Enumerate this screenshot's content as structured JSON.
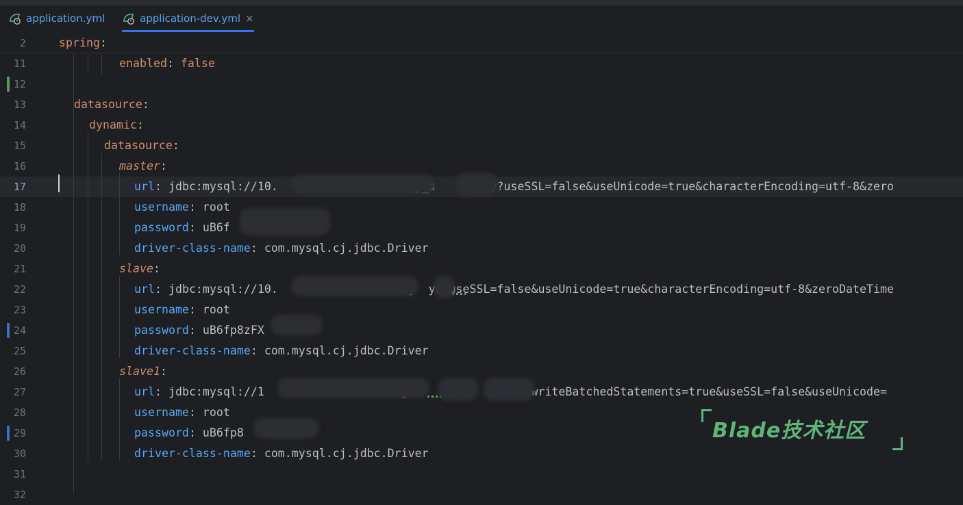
{
  "tabs": [
    {
      "label": "application.yml",
      "active": false
    },
    {
      "label": "application-dev.yml",
      "active": true,
      "close": "×"
    }
  ],
  "sticky": {
    "num": "2",
    "key": "spring",
    "colon": ":"
  },
  "lines": [
    {
      "num": "11",
      "indent": "    ",
      "key": "enabled",
      "colon": ": ",
      "value": "false"
    },
    {
      "num": "12"
    },
    {
      "num": "13",
      "indent": " ",
      "key": "datasource",
      "colon": ":"
    },
    {
      "num": "14",
      "indent": "  ",
      "key": "dynamic",
      "colon": ":"
    },
    {
      "num": "15",
      "indent": "   ",
      "key": "datasource",
      "colon": ":"
    },
    {
      "num": "16",
      "indent": "    ",
      "key": "master",
      "colon": ":"
    },
    {
      "num": "17",
      "indent": "     ",
      "key": "url",
      "colon": ": ",
      "value": "jdbc:mysql://10.                    y_s     city?useSSL=false&useUnicode=true&characterEncoding=utf-8&zero"
    },
    {
      "num": "18",
      "indent": "     ",
      "key": "username",
      "colon": ": ",
      "value": "root"
    },
    {
      "num": "19",
      "indent": "     ",
      "key": "password",
      "colon": ": ",
      "value": "uB6f"
    },
    {
      "num": "20",
      "indent": "     ",
      "key": "driver-class-name",
      "colon": ": ",
      "value": "com.mysql.cj.jdbc.Driver"
    },
    {
      "num": "21",
      "indent": "    ",
      "key": "slave",
      "colon": ":"
    },
    {
      "num": "22",
      "indent": "     ",
      "key": "url",
      "colon": ": ",
      "value": "jdbc:mysql://10.                  /j  yu?useSSL=false&useUnicode=true&characterEncoding=utf-8&zeroDateTime"
    },
    {
      "num": "23",
      "indent": "     ",
      "key": "username",
      "colon": ": ",
      "value": "root"
    },
    {
      "num": "24",
      "indent": "     ",
      "key": "password",
      "colon": ": ",
      "value": "uB6fp8zFX"
    },
    {
      "num": "25",
      "indent": "     ",
      "key": "driver-class-name",
      "colon": ": ",
      "value": "com.mysql.cj.jdbc.Driver"
    },
    {
      "num": "26",
      "indent": "    ",
      "key": "slave1",
      "colon": ":"
    },
    {
      "num": "27",
      "indent": "     ",
      "key": "url",
      "colon": ": ",
      "value": "jdbc:mysql://1                    ji    la      er?rewriteBatchedStatements=true&useSSL=false&useUnicode="
    },
    {
      "num": "28",
      "indent": "     ",
      "key": "username",
      "colon": ": ",
      "value": "root"
    },
    {
      "num": "29",
      "indent": "     ",
      "key": "password",
      "colon": ": ",
      "value": "uB6fp8"
    },
    {
      "num": "30",
      "indent": "     ",
      "key": "driver-class-name",
      "colon": ": ",
      "value": "com.mysql.cj.jdbc.Driver"
    },
    {
      "num": "31"
    },
    {
      "num": "32"
    }
  ],
  "watermark": "Blade技术社区",
  "colors": {
    "key": "#cf8e6d",
    "blueKey": "#56a8f5",
    "text": "#bcbec4",
    "accent": "#3574f0",
    "watermark": "#5fb57a"
  }
}
